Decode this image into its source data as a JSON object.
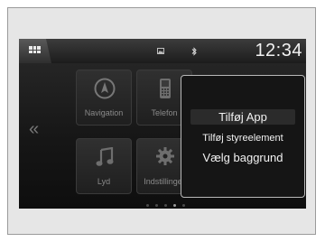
{
  "status_bar": {
    "menu_icon": "apps-grid-icon",
    "icons": [
      "picture-icon",
      "bluetooth-icon"
    ],
    "clock": "12:34"
  },
  "home": {
    "tiles": [
      {
        "label": "Navigation",
        "icon": "navigation-compass-icon"
      },
      {
        "label": "Telefon",
        "icon": "phone-icon"
      },
      {
        "label": "Lyd",
        "icon": "music-note-icon"
      },
      {
        "label": "Indstillinger",
        "icon": "gear-icon"
      }
    ],
    "prev_page_icon": "double-chevron-left-icon",
    "pages": 5,
    "current_page": 4
  },
  "popup_menu": {
    "items": [
      "Tilføj App",
      "Tilføj styreelement",
      "Vælg baggrund"
    ],
    "highlighted_index": 0
  }
}
